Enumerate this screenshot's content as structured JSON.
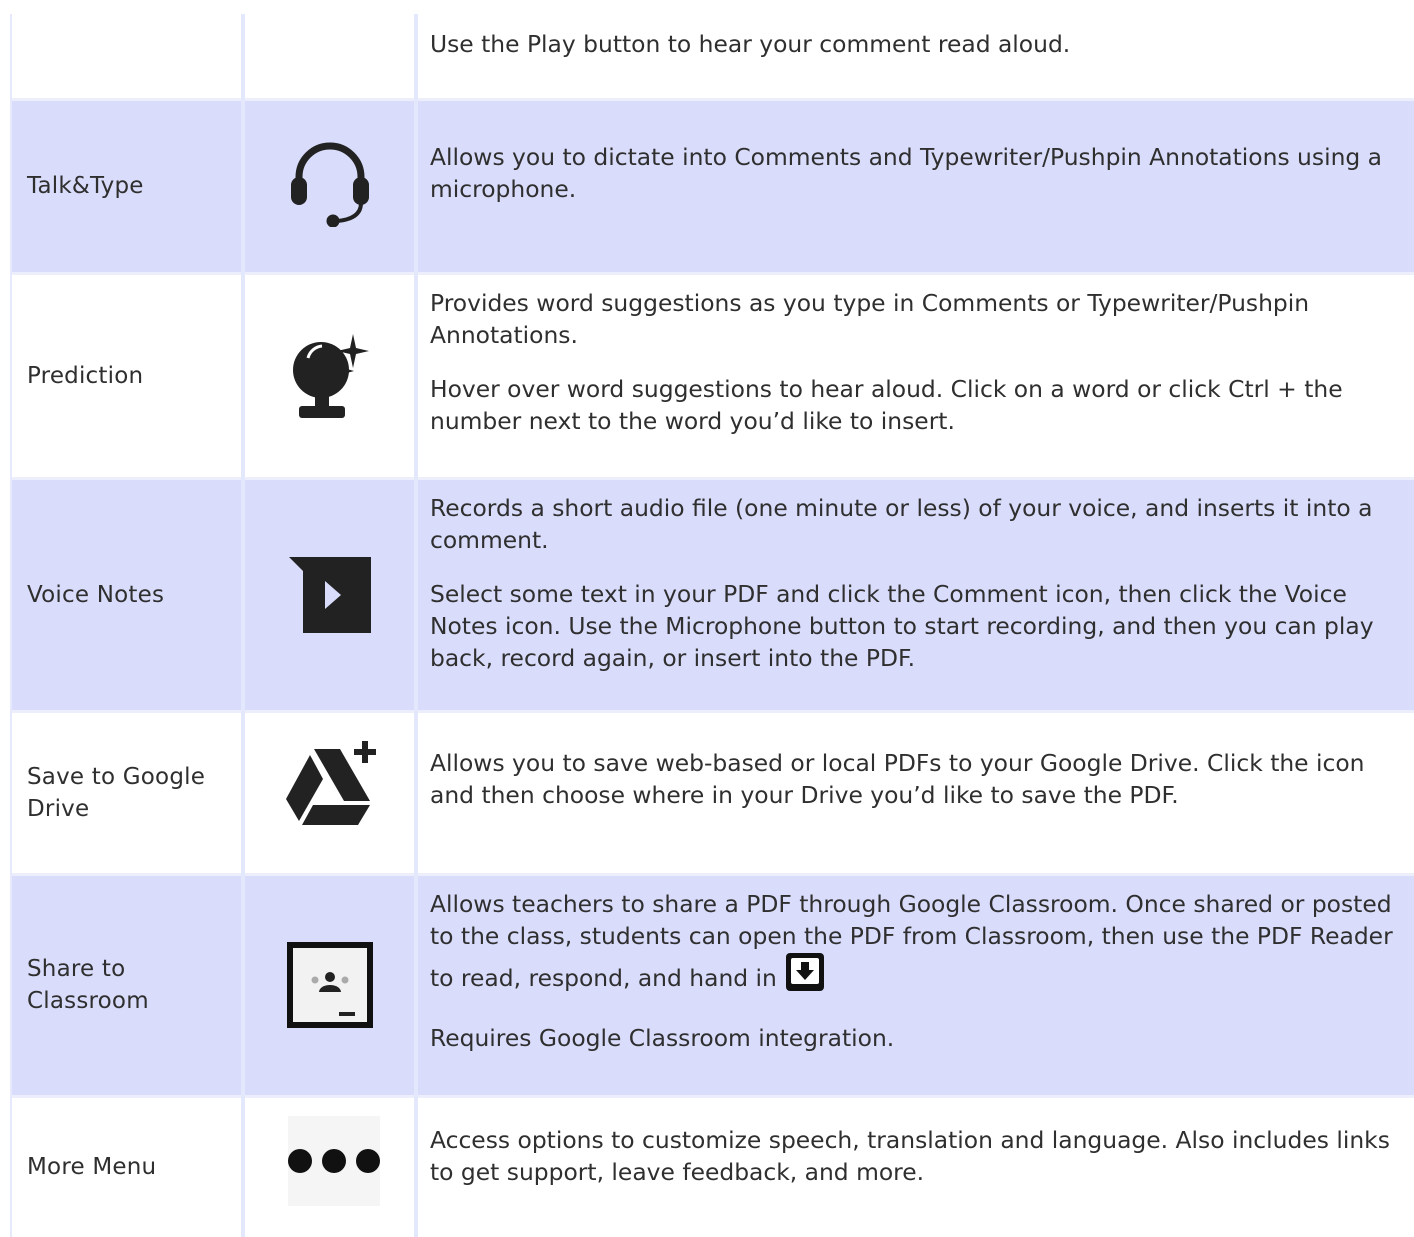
{
  "rows": [
    {
      "name": "",
      "icon": "none",
      "desc": [
        "Use the Play button to hear your comment read aloud."
      ]
    },
    {
      "name": "Talk&Type",
      "icon": "headset-icon",
      "desc": [
        "Allows you to dictate into Comments and Typewriter/Pushpin Annotations using a microphone."
      ]
    },
    {
      "name": "Prediction",
      "icon": "crystal-ball-icon",
      "desc": [
        "Provides word suggestions as you type in Comments or Typewriter/Pushpin Annotations.",
        "Hover over word suggestions to hear aloud. Click on a word or click Ctrl + the number next to the word you’d like to insert."
      ]
    },
    {
      "name": "Voice Notes",
      "icon": "voice-note-icon",
      "desc": [
        "Records a short audio file (one minute or less) of your voice, and inserts it into a comment.",
        "Select some text in your PDF and click the Comment icon, then click the Voice Notes icon. Use the Microphone button to start recording, and then you can play back, record again, or insert into the PDF."
      ]
    },
    {
      "name": "Save to Google Drive",
      "icon": "google-drive-add-icon",
      "desc": [
        "Allows you to save web-based or local PDFs to your Google Drive. Click the icon and then choose where in your Drive you’d like to save the PDF."
      ]
    },
    {
      "name": "Share to Classroom",
      "icon": "classroom-icon",
      "desc": [
        "Allows teachers to share a PDF through Google Classroom. Once shared or posted to the class, students can open the PDF from Classroom, then use the PDF Reader to read, respond, and hand in",
        "Requires Google Classroom integration."
      ],
      "inline_icon": "hand-in-icon"
    },
    {
      "name": "More Menu",
      "icon": "more-dots-icon",
      "desc": [
        "Access options to customize speech, translation and language. Also includes links to get support, leave feedback, and more."
      ]
    }
  ],
  "colors": {
    "shaded_row": "#d9ddfb",
    "divider": "#e4e8fd",
    "text": "#2f2f2f",
    "icon": "#222222"
  }
}
